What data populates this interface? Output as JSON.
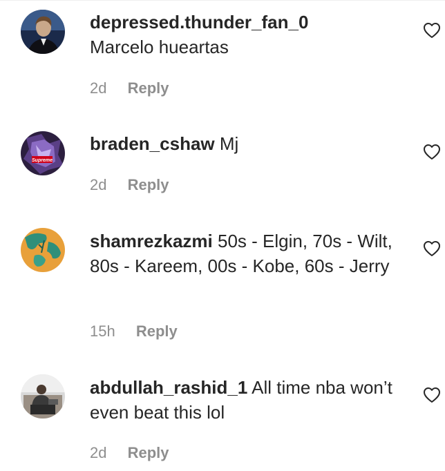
{
  "comments": [
    {
      "username": "depressed.thunder_fan_0",
      "text": "Marcelo hueartas",
      "time": "2d",
      "reply_label": "Reply",
      "avatar_icon": "profile-photo-man-portrait",
      "avatar_colors": [
        "#1b2a4a",
        "#c9a88a"
      ]
    },
    {
      "username": "braden_cshaw",
      "text": "Mj",
      "time": "2d",
      "reply_label": "Reply",
      "avatar_icon": "profile-photo-purple-supreme-graphic",
      "avatar_badge": "Supreme",
      "avatar_colors": [
        "#2c1f3f",
        "#8b6bc4",
        "#d0021b"
      ]
    },
    {
      "username": "shamrezkazmi",
      "text": "50s - Elgin, 70s - Wilt, 80s - Kareem, 00s - Kobe, 60s - Jerry",
      "time": "15h",
      "reply_label": "Reply",
      "avatar_icon": "profile-photo-teal-on-orange",
      "avatar_colors": [
        "#e8a03a",
        "#2f8f7a"
      ]
    },
    {
      "username": "abdullah_rashid_1",
      "text": "All time nba won’t even beat this lol",
      "time": "2d",
      "reply_label": "Reply",
      "avatar_icon": "profile-photo-person-seated",
      "avatar_colors": [
        "#d9d9d9",
        "#3a3a3a"
      ]
    }
  ],
  "like_icon": "heart-outline-icon"
}
